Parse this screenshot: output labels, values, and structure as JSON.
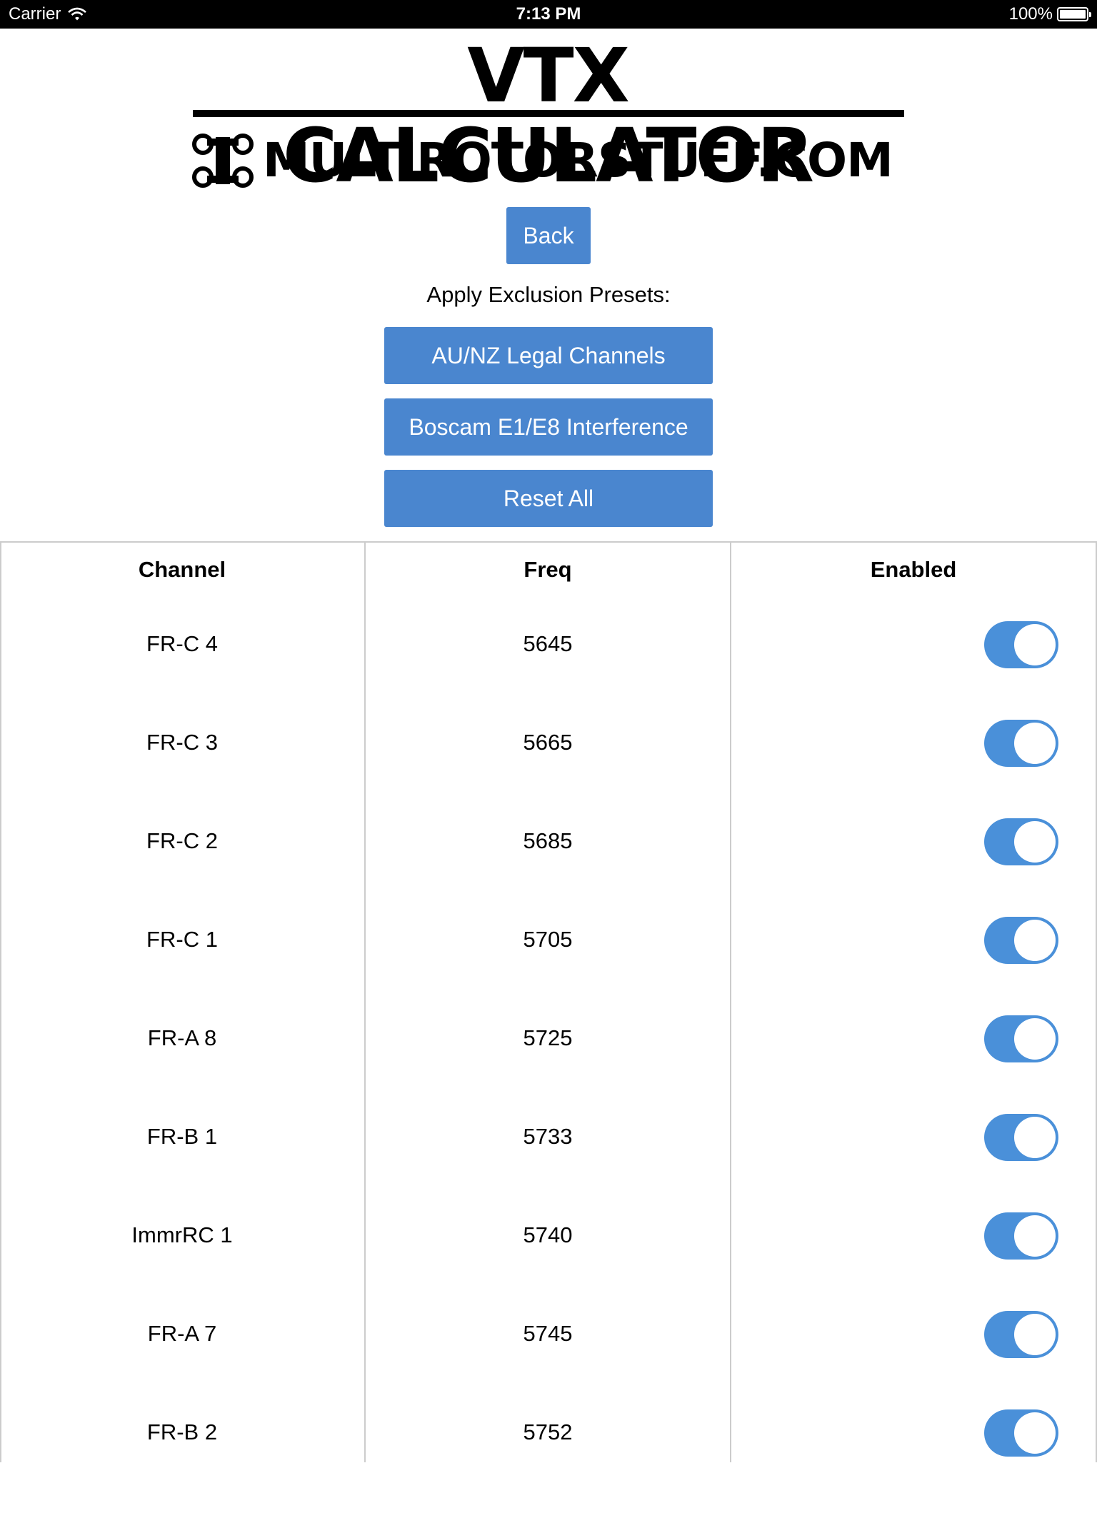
{
  "status_bar": {
    "carrier": "Carrier",
    "time": "7:13 PM",
    "battery": "100%"
  },
  "header": {
    "title": "VTX CALCULATOR",
    "subtitle": "MULTIROTORSTUFF.COM",
    "logo_icon": "drone-icon"
  },
  "nav": {
    "back_label": "Back"
  },
  "presets": {
    "label": "Apply Exclusion Presets:",
    "buttons": [
      "AU/NZ Legal Channels",
      "Boscam E1/E8 Interference",
      "Reset All"
    ]
  },
  "table": {
    "headers": [
      "Channel",
      "Freq",
      "Enabled"
    ],
    "rows": [
      {
        "channel": "FR-C 4",
        "freq": "5645",
        "enabled": true
      },
      {
        "channel": "FR-C 3",
        "freq": "5665",
        "enabled": true
      },
      {
        "channel": "FR-C 2",
        "freq": "5685",
        "enabled": true
      },
      {
        "channel": "FR-C 1",
        "freq": "5705",
        "enabled": true
      },
      {
        "channel": "FR-A 8",
        "freq": "5725",
        "enabled": true
      },
      {
        "channel": "FR-B 1",
        "freq": "5733",
        "enabled": true
      },
      {
        "channel": "ImmrRC 1",
        "freq": "5740",
        "enabled": true
      },
      {
        "channel": "FR-A 7",
        "freq": "5745",
        "enabled": true
      },
      {
        "channel": "FR-B 2",
        "freq": "5752",
        "enabled": true
      }
    ]
  },
  "colors": {
    "button": "#4a86cf",
    "toggle_on": "#4a90d9",
    "status_bar": "#000000",
    "grid": "#cccccc"
  }
}
